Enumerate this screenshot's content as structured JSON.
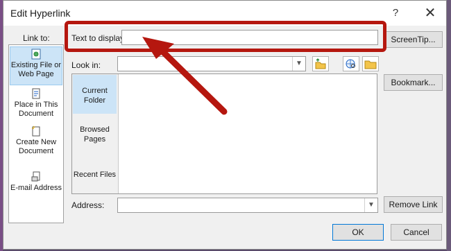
{
  "title": "Edit Hyperlink",
  "help_label": "?",
  "close_label": "✕",
  "link_to_label": "Link to:",
  "text_to_display": {
    "label": "Text to display:",
    "value": ""
  },
  "screentip_label": "ScreenTip...",
  "sidebar": [
    {
      "label1": "Existing File or",
      "label2": "Web Page",
      "icon": "existing-file-icon"
    },
    {
      "label1": "Place in This",
      "label2": "Document",
      "icon": "place-in-document-icon"
    },
    {
      "label1": "Create New",
      "label2": "Document",
      "icon": "create-new-document-icon"
    },
    {
      "label1": "E-mail Address",
      "label2": "",
      "icon": "email-address-icon"
    }
  ],
  "look_in": {
    "label": "Look in:",
    "value": ""
  },
  "bookmark_label": "Bookmark...",
  "browse_tabs": [
    {
      "label1": "Current",
      "label2": "Folder"
    },
    {
      "label1": "Browsed",
      "label2": "Pages"
    },
    {
      "label1": "Recent Files",
      "label2": ""
    }
  ],
  "address": {
    "label": "Address:",
    "value": ""
  },
  "remove_link_label": "Remove Link",
  "ok_label": "OK",
  "cancel_label": "Cancel",
  "colors": {
    "highlight": "#b5170f",
    "active_bg": "#cce4f7"
  }
}
